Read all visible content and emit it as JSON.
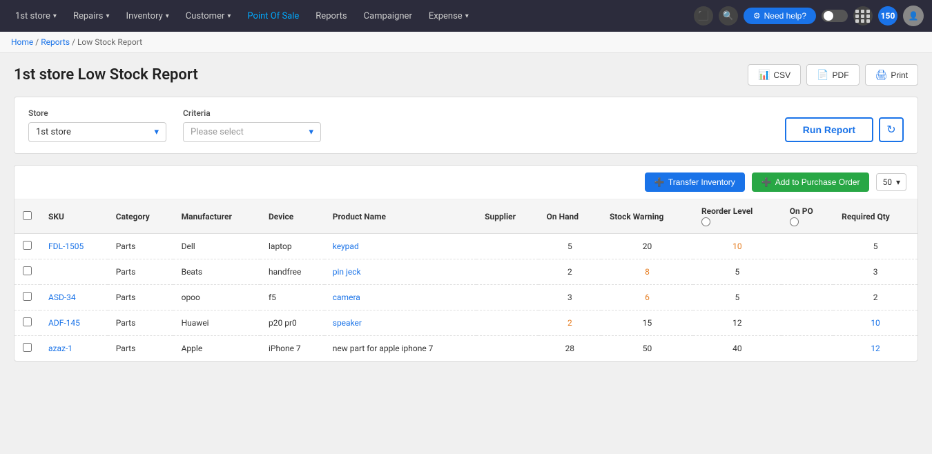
{
  "nav": {
    "store_label": "1st store",
    "items": [
      {
        "label": "Repairs",
        "has_chevron": true,
        "active": false
      },
      {
        "label": "Inventory",
        "has_chevron": true,
        "active": false
      },
      {
        "label": "Customer",
        "has_chevron": true,
        "active": false
      },
      {
        "label": "Point Of Sale",
        "has_chevron": false,
        "active": true
      },
      {
        "label": "Reports",
        "has_chevron": false,
        "active": false
      },
      {
        "label": "Campaigner",
        "has_chevron": false,
        "active": false
      },
      {
        "label": "Expense",
        "has_chevron": true,
        "active": false
      }
    ],
    "need_help": "Need help?",
    "badge_count": "150"
  },
  "breadcrumb": {
    "home": "Home",
    "reports": "Reports",
    "current": "Low Stock Report"
  },
  "page": {
    "title": "1st store Low Stock Report",
    "csv_label": "CSV",
    "pdf_label": "PDF",
    "print_label": "Print"
  },
  "filters": {
    "store_label": "Store",
    "store_value": "1st store",
    "criteria_label": "Criteria",
    "criteria_placeholder": "Please select",
    "run_report_label": "Run Report"
  },
  "toolbar": {
    "transfer_label": "Transfer Inventory",
    "add_po_label": "Add to Purchase Order",
    "page_size": "50"
  },
  "table": {
    "headers": [
      "SKU",
      "Category",
      "Manufacturer",
      "Device",
      "Product Name",
      "Supplier",
      "On Hand",
      "Stock Warning",
      "Reorder Level",
      "On PO",
      "Required Qty"
    ],
    "rows": [
      {
        "sku": "FDL-1505",
        "sku_link": true,
        "category": "Parts",
        "manufacturer": "Dell",
        "device": "laptop",
        "product_name": "keypad",
        "product_link": true,
        "supplier": "",
        "on_hand": "5",
        "stock_warning": "20",
        "reorder_level": "10",
        "reorder_orange": true,
        "on_po": "",
        "required_qty": "5"
      },
      {
        "sku": "",
        "sku_link": false,
        "category": "Parts",
        "manufacturer": "Beats",
        "device": "handfree",
        "product_name": "pin jeck",
        "product_link": true,
        "supplier": "",
        "on_hand": "2",
        "stock_warning": "8",
        "stock_warning_orange": true,
        "reorder_level": "5",
        "reorder_orange": false,
        "on_po": "",
        "required_qty": "3"
      },
      {
        "sku": "ASD-34",
        "sku_link": true,
        "category": "Parts",
        "manufacturer": "opoo",
        "device": "f5",
        "product_name": "camera",
        "product_link": true,
        "supplier": "",
        "on_hand": "3",
        "stock_warning": "6",
        "stock_warning_orange": true,
        "reorder_level": "5",
        "reorder_orange": false,
        "on_po": "",
        "required_qty": "2"
      },
      {
        "sku": "ADF-145",
        "sku_link": true,
        "category": "Parts",
        "manufacturer": "Huawei",
        "device": "p20 pr0",
        "product_name": "speaker",
        "product_link": true,
        "supplier": "",
        "on_hand": "2",
        "on_hand_orange": true,
        "stock_warning": "15",
        "reorder_level": "12",
        "reorder_orange": false,
        "on_po": "",
        "required_qty": "10"
      },
      {
        "sku": "azaz-1",
        "sku_link": true,
        "category": "Parts",
        "manufacturer": "Apple",
        "device": "iPhone 7",
        "product_name": "new part for apple iphone 7",
        "product_link": false,
        "supplier": "",
        "on_hand": "28",
        "stock_warning": "50",
        "reorder_level": "40",
        "reorder_orange": false,
        "on_po": "",
        "required_qty": "12"
      }
    ]
  }
}
